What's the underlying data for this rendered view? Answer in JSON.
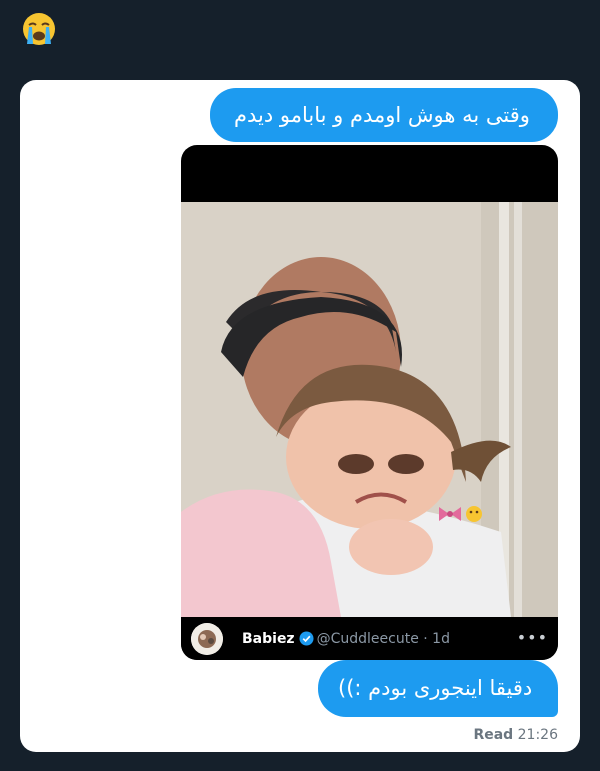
{
  "header": {
    "emoji_icon": "loudly-crying-face-icon"
  },
  "messages": [
    {
      "text": "وقتی به هوش اومدم و بابامو دیدم"
    },
    {
      "text": "دقیقا اینجوری بودم :))"
    }
  ],
  "tweet": {
    "author_name": "Babiez",
    "handle": "@Cuddleecute · 1d",
    "more_icon": "more-horizontal-icon"
  },
  "status": {
    "read_label": "Read",
    "time": "21:26"
  },
  "colors": {
    "background": "#15202b",
    "bubble": "#1d9bf0",
    "card": "#ffffff"
  }
}
